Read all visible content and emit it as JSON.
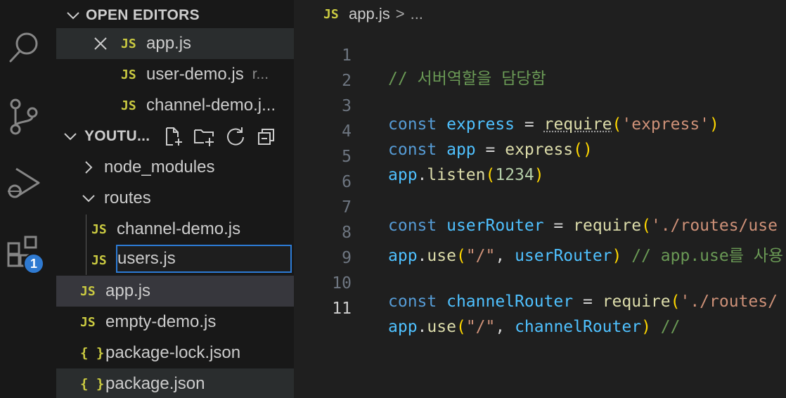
{
  "activity_bar": {
    "icons": [
      "search-icon",
      "source-control-icon",
      "run-debug-icon",
      "extensions-icon"
    ],
    "extensions_badge": "1"
  },
  "explorer": {
    "open_editors": {
      "title": "OPEN EDITORS",
      "items": [
        {
          "icon": "JS",
          "name": "app.js",
          "extra": ""
        },
        {
          "icon": "JS",
          "name": "user-demo.js",
          "extra": "r..."
        },
        {
          "icon": "JS",
          "name": "channel-demo.j...",
          "extra": ""
        }
      ]
    },
    "project": {
      "title": "YOUTU...",
      "toolbar_icons": [
        "new-file-icon",
        "new-folder-icon",
        "refresh-icon",
        "collapse-all-icon"
      ],
      "tree": [
        {
          "name": "node_modules",
          "type": "folder"
        },
        {
          "name": "routes",
          "type": "folder"
        },
        {
          "icon": "JS",
          "name": "channel-demo.js"
        },
        {
          "icon": "JS",
          "rename_value": "users.js"
        },
        {
          "icon": "JS",
          "name": "app.js"
        },
        {
          "icon": "JS",
          "name": "empty-demo.js"
        },
        {
          "icon": "{ }",
          "name": "package-lock.json"
        },
        {
          "icon": "{ }",
          "name": "package.json"
        }
      ]
    }
  },
  "editor": {
    "breadcrumb": {
      "icon": "JS",
      "file": "app.js",
      "sep": ">",
      "more": "..."
    },
    "line_numbers": [
      "1",
      "2",
      "3",
      "4",
      "5",
      "6",
      "7",
      "8",
      "9",
      "10",
      "11"
    ],
    "code": {
      "l1": "// 서버역할을 담당함",
      "l3": [
        "const",
        " express ",
        "=",
        " ",
        "require",
        "(",
        "'express'",
        ")"
      ],
      "l4": [
        "const",
        " app ",
        "=",
        " ",
        "express",
        "(",
        ")"
      ],
      "l5": [
        "app",
        ".",
        "listen",
        "(",
        "1234",
        ")"
      ],
      "l7": [
        "const",
        " userRouter ",
        "=",
        " ",
        "require",
        "(",
        "'./routes/use"
      ],
      "l8": [
        "app",
        ".",
        "use",
        "(",
        "\"/\"",
        ", ",
        "userRouter",
        ")",
        " // app.use를 사용"
      ],
      "l10": [
        "const",
        " channelRouter ",
        "=",
        " ",
        "require",
        "(",
        "'./routes/"
      ],
      "l11": [
        "app",
        ".",
        "use",
        "(",
        "\"/\"",
        ", ",
        "channelRouter",
        ")",
        " //"
      ]
    }
  }
}
